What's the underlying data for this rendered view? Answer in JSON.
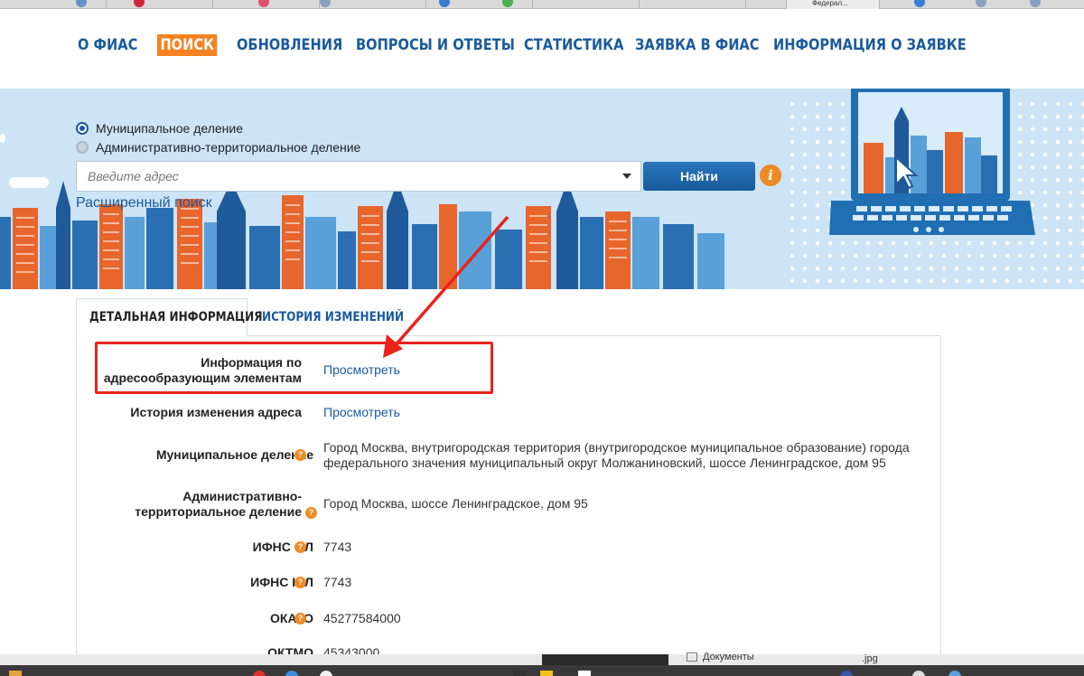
{
  "browser": {
    "active_tab_title": "Федерал..."
  },
  "nav": {
    "items": [
      {
        "label": "О ФИАС"
      },
      {
        "label": "ПОИСК"
      },
      {
        "label": "ОБНОВЛЕНИЯ"
      },
      {
        "label": "ВОПРОСЫ И ОТВЕТЫ"
      },
      {
        "label": "СТАТИСТИКА"
      },
      {
        "label": "ЗАЯВКА В ФИАС"
      },
      {
        "label": "ИНФОРМАЦИЯ О ЗАЯВКЕ"
      }
    ],
    "active_index": 1
  },
  "search": {
    "radio_municipal": "Муниципальное деление",
    "radio_admin": "Административно-территориальное деление",
    "selected": "municipal",
    "placeholder": "Введите адрес",
    "button_label": "Найти",
    "info_icon": "i",
    "advanced_link": "Расширенный поиск"
  },
  "tabs": {
    "detail": "ДЕТАЛЬНАЯ ИНФОРМАЦИЯ",
    "history": "ИСТОРИЯ ИЗМЕНЕНИЙ"
  },
  "details": {
    "rows": [
      {
        "label_line1": "Информация по",
        "label_line2": "адресообразующим элементам",
        "value": "Просмотреть"
      },
      {
        "label_line1": "История изменения адреса",
        "value": "Просмотреть"
      },
      {
        "label_line1": "Муниципальное деление",
        "value_line1": "Город Москва, внутригородская территория (внутригородское муниципальное образование) города",
        "value_line2": "федерального значения муниципальный округ Молжаниновский, шоссе Ленинградское, дом 95"
      },
      {
        "label_line1": "Административно-",
        "label_line2": "территориальное деление",
        "value": "Город Москва, шоссе Ленинградское, дом 95"
      },
      {
        "label_line1": "ИФНС ФЛ",
        "value": "7743"
      },
      {
        "label_line1": "ИФНС ЮЛ",
        "value": "7743"
      },
      {
        "label_line1": "ОКАТО",
        "value": "45277584000"
      },
      {
        "label_line1": "ОКТМО",
        "value": "45343000"
      }
    ],
    "help_icon": "?"
  },
  "taskbar": {
    "documents_label": "Документы",
    "file_ext": ".jpg"
  },
  "colors": {
    "brand_blue": "#1a5a9c",
    "accent_orange": "#f58220",
    "highlight_red": "#e8241c",
    "banner_bg": "#cce4f6"
  }
}
